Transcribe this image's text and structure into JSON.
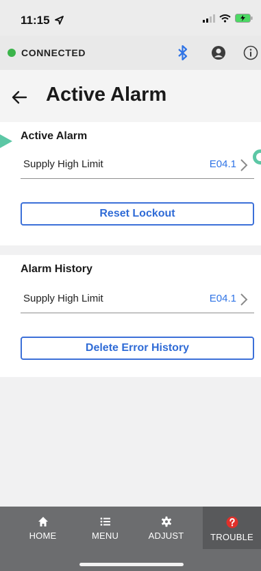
{
  "status_bar": {
    "time": "11:15"
  },
  "connection": {
    "status": "CONNECTED",
    "indicator_color": "#3bb44a",
    "bluetooth_color": "#2f74e6"
  },
  "header": {
    "title": "Active Alarm"
  },
  "active_alarm": {
    "section_title": "Active Alarm",
    "row": {
      "label": "Supply High Limit",
      "code": "E04.1"
    },
    "button": "Reset Lockout"
  },
  "alarm_history": {
    "section_title": "Alarm History",
    "row": {
      "label": "Supply High Limit",
      "code": "E04.1"
    },
    "button": "Delete Error History"
  },
  "tabs": [
    {
      "label": "HOME",
      "icon": "home-icon"
    },
    {
      "label": "MENU",
      "icon": "menu-icon"
    },
    {
      "label": "ADJUST",
      "icon": "gear-icon"
    },
    {
      "label": "TROUBLE",
      "icon": "question-icon",
      "active": true
    }
  ],
  "colors": {
    "accent": "#2f74e6",
    "tab_bar": "#6c6d6f",
    "trouble_icon": "#e0302a"
  }
}
